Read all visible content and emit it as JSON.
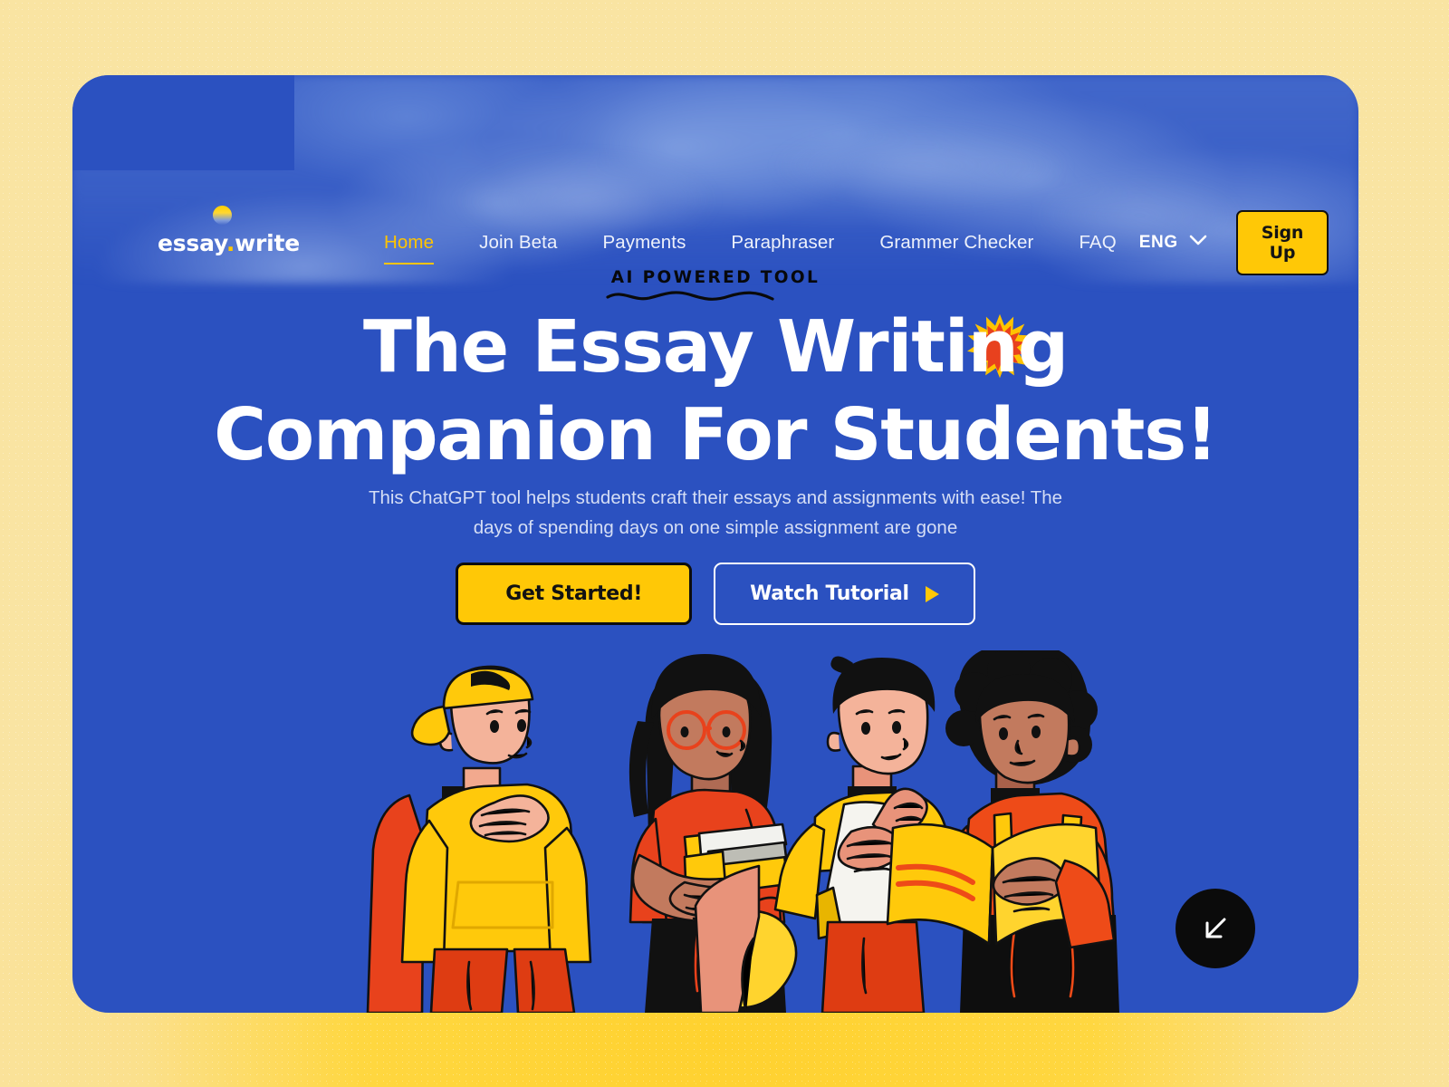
{
  "brand": {
    "name_primary": "essay",
    "name_dot": ".",
    "name_secondary": "write",
    "accent_yellow": "#FFC806",
    "card_blue": "#2B51C0",
    "page_bg": "#F9E4A2"
  },
  "nav": {
    "items": [
      {
        "label": "Home",
        "active": true
      },
      {
        "label": "Join Beta",
        "active": false
      },
      {
        "label": "Payments",
        "active": false
      },
      {
        "label": "Paraphraser",
        "active": false
      },
      {
        "label": "Grammer Checker",
        "active": false
      },
      {
        "label": "FAQ",
        "active": false
      }
    ],
    "language": "ENG",
    "signup_label": "Sign Up"
  },
  "hero": {
    "eyebrow": "AI  POWERED TOOL",
    "headline_line1": "The Essay Writing",
    "headline_line2": "Companion For Students!",
    "subtitle": "This ChatGPT tool helps students craft their essays and assignments with ease! The days of spending days on one simple assignment are gone",
    "primary_cta": "Get Started!",
    "secondary_cta": "Watch Tutorial"
  },
  "scroll": {
    "label": "scroll-down"
  }
}
